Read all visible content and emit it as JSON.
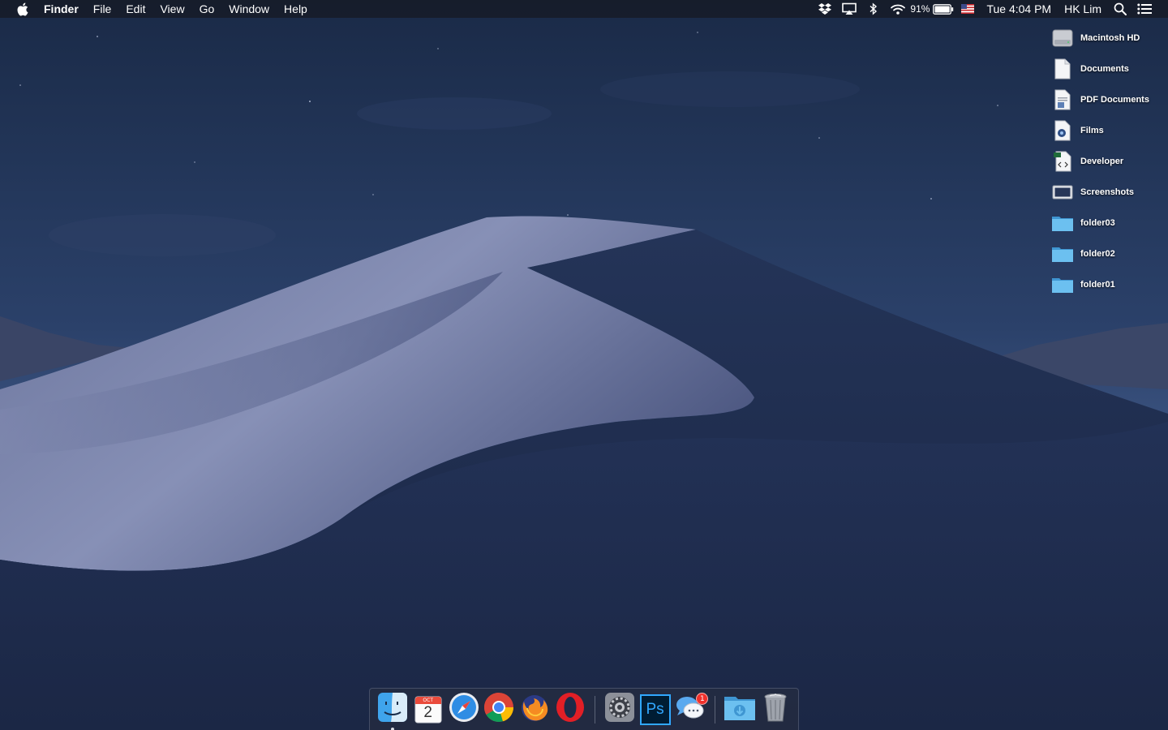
{
  "menubar": {
    "app_name": "Finder",
    "menus": [
      "File",
      "Edit",
      "View",
      "Go",
      "Window",
      "Help"
    ],
    "status": {
      "icons": [
        "dropbox-icon",
        "airplay-icon",
        "bluetooth-icon",
        "wifi-icon"
      ],
      "battery_percent": "91%",
      "input_source": "us-flag-icon",
      "clock": "Tue 4:04 PM",
      "user": "HK Lim",
      "right_icons": [
        "spotlight-icon",
        "notification-center-icon"
      ]
    }
  },
  "desktop": {
    "items": [
      {
        "label": "Macintosh HD",
        "icon": "hard-drive-icon"
      },
      {
        "label": "Documents",
        "icon": "document-icon"
      },
      {
        "label": "PDF Documents",
        "icon": "pdf-document-icon"
      },
      {
        "label": "Films",
        "icon": "film-document-icon"
      },
      {
        "label": "Developer",
        "icon": "code-document-icon"
      },
      {
        "label": "Screenshots",
        "icon": "screenshot-icon"
      },
      {
        "label": "folder03",
        "icon": "folder-icon"
      },
      {
        "label": "folder02",
        "icon": "folder-icon"
      },
      {
        "label": "folder01",
        "icon": "folder-icon"
      }
    ]
  },
  "dock": {
    "apps": [
      {
        "name": "finder-icon",
        "running": true
      },
      {
        "name": "calendar-icon",
        "month": "OCT",
        "day": "2"
      },
      {
        "name": "safari-icon"
      },
      {
        "name": "chrome-icon"
      },
      {
        "name": "firefox-icon"
      },
      {
        "name": "opera-icon"
      },
      {
        "name": "system-preferences-icon"
      },
      {
        "name": "photoshop-icon",
        "label": "Ps"
      },
      {
        "name": "messages-icon",
        "badge": "1"
      },
      {
        "name": "downloads-folder-icon"
      },
      {
        "name": "trash-icon"
      }
    ]
  },
  "colors": {
    "menubar_bg": "#161a24",
    "sky_top": "#1d2f4f",
    "sky_horizon": "#3a5279",
    "dune_light": "#8a93b8",
    "dune_shadow": "#1a2748",
    "folder_blue": "#5fb3e8",
    "badge_red": "#f0302b",
    "photoshop_blue": "#31a8ff"
  }
}
